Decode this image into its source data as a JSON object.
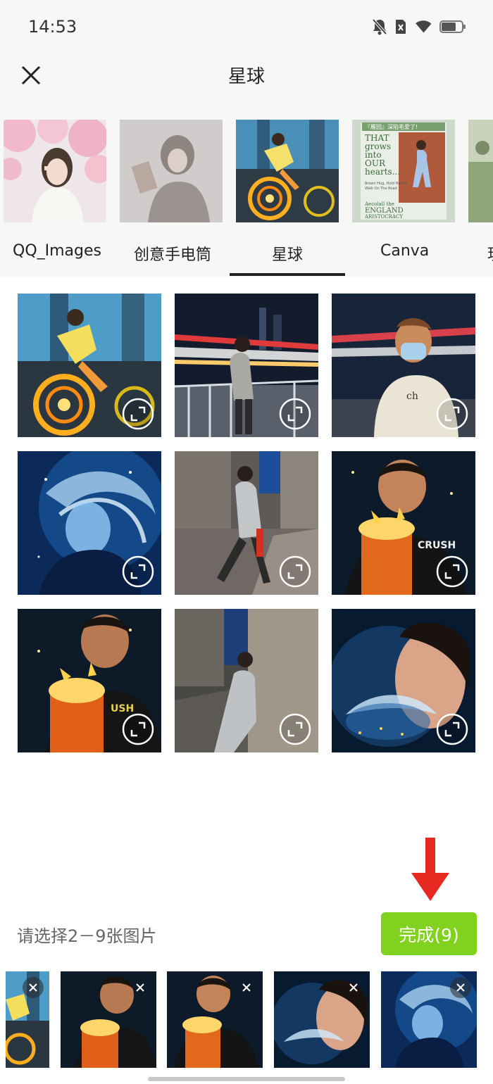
{
  "status": {
    "time": "14:53"
  },
  "header": {
    "title": "星球"
  },
  "albums": [
    {
      "label": "QQ_Images",
      "active": false
    },
    {
      "label": "创意手电筒",
      "active": false
    },
    {
      "label": "星球",
      "active": true
    },
    {
      "label": "Canva",
      "active": false
    },
    {
      "label": "現",
      "active": false
    }
  ],
  "album_cover_text": {
    "banner": "『雁园』深陷毛爱了!",
    "line1": "THAT",
    "line2": "grows",
    "line3": "into",
    "line4": "OUR",
    "line5": "hearts...",
    "caption1": "Brown Hug, Hold Hands.",
    "caption2": "Walk On The Road",
    "footer1": "Aecolall the",
    "footer2": "ENGLAND",
    "footer3": "ARISTOCRACY"
  },
  "photo_text": {
    "shirt_logo": "ch",
    "shirt_print": "CRUSH",
    "shirt_print2": "USH"
  },
  "footer": {
    "prompt": "请选择2－9张图片",
    "done_label": "完成(9)"
  },
  "colors": {
    "accent": "#80d21f",
    "arrow": "#e62a22",
    "background_bar": "#f7f7f7"
  }
}
